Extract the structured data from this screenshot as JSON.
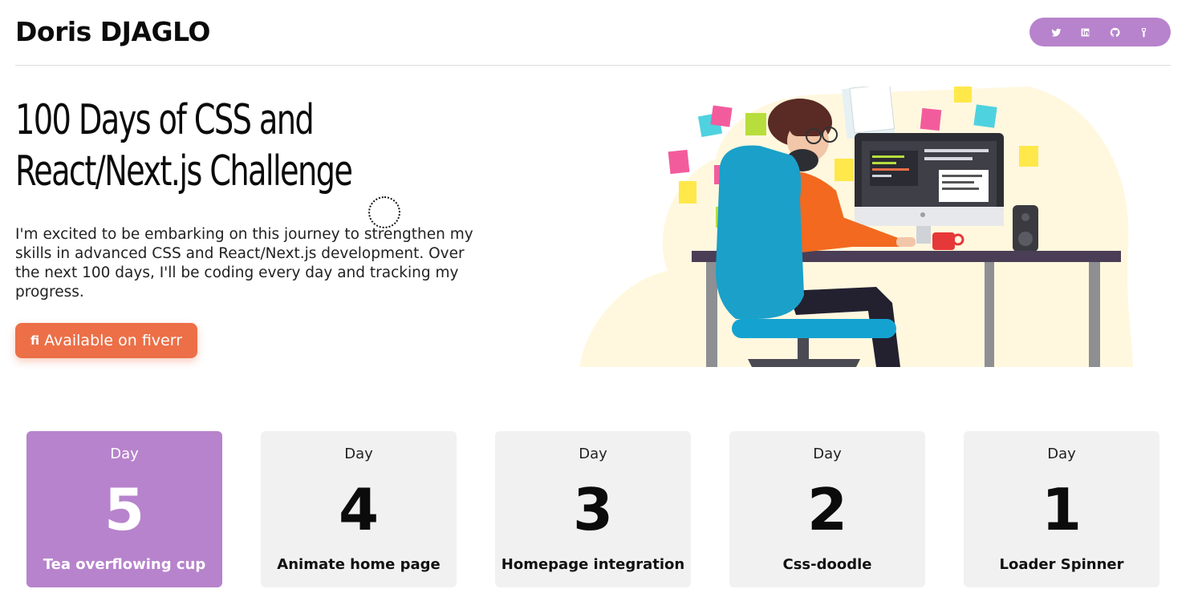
{
  "header": {
    "brand": "Doris DJAGLO",
    "social": [
      {
        "name": "twitter-icon"
      },
      {
        "name": "linkedin-icon"
      },
      {
        "name": "github-icon"
      },
      {
        "name": "codepen-icon"
      }
    ]
  },
  "hero": {
    "title_line1": "100 Days of CSS and",
    "title_line2": "React/Next.js Challenge",
    "description": "I'm excited to be embarking on this journey to strengthen my skills in advanced CSS and React/Next.js development. Over the next 100 days, I'll be coding every day and tracking my progress.",
    "cta_icon": "fi",
    "cta_label": "Available on fiverr"
  },
  "colors": {
    "accent": "#b783cc",
    "cta": "#ec6f47",
    "card_bg": "#f1f1f1"
  },
  "cards": [
    {
      "label": "Day",
      "number": "5",
      "title": "Tea overflowing cup",
      "active": true
    },
    {
      "label": "Day",
      "number": "4",
      "title": "Animate home page",
      "active": false
    },
    {
      "label": "Day",
      "number": "3",
      "title": "Homepage integration",
      "active": false
    },
    {
      "label": "Day",
      "number": "2",
      "title": "Css-doodle",
      "active": false
    },
    {
      "label": "Day",
      "number": "1",
      "title": "Loader Spinner",
      "active": false
    }
  ]
}
